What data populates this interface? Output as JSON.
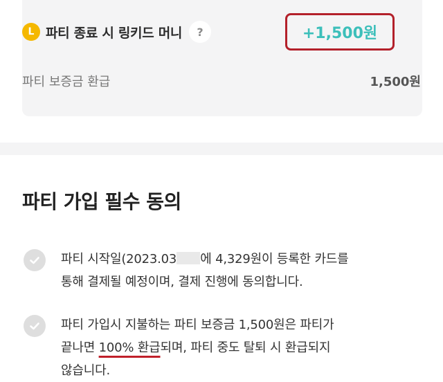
{
  "summary": {
    "coin_icon_letter": "L",
    "money_label": "파티 종료 시 링키드 머니",
    "help_icon_glyph": "?",
    "money_value": "+1,500원",
    "deposit_label": "파티 보증금 환급",
    "deposit_value": "1,500원"
  },
  "agreement": {
    "title": "파티 가입 필수 동의",
    "items": [
      {
        "text_before_blur": "파티 시작일(2023.03",
        "text_after_blur": "에 4,329원이 등록한 카드를",
        "line2": "통해 결제될 예정이며, 결제 진행에 동의합니다."
      },
      {
        "line1": "파티 가입시 지불하는 파티 보증금 1,500원은 파티가",
        "line2_before": "끝나면 ",
        "line2_underlined": "100% 환급",
        "line2_after": "되며, 파티 중도 탈퇴 시 환급되지",
        "line3": "않습니다."
      }
    ]
  },
  "colors": {
    "accent_teal": "#3cbfba",
    "highlight_red": "#b3202a",
    "coin_yellow": "#f5b800"
  },
  "icons": [
    "coin-L-icon",
    "help-icon",
    "check-circle-icon"
  ]
}
